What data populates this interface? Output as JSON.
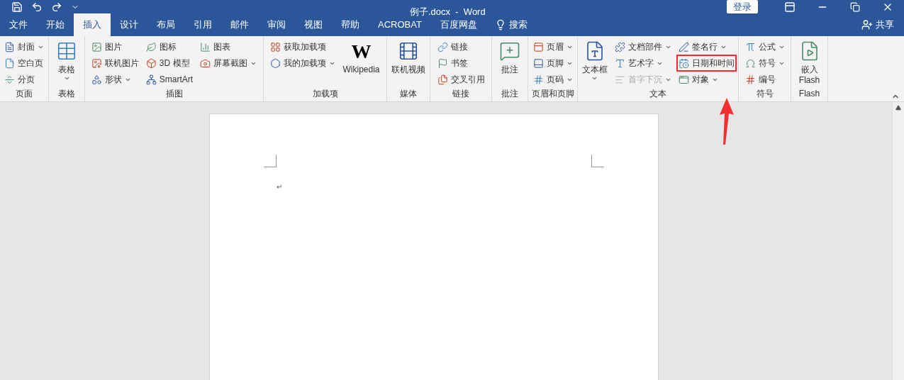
{
  "title_bar": {
    "title": "例子.docx  -  Word",
    "sign_in": "登录"
  },
  "tabs": [
    {
      "label": "文件",
      "selected": false
    },
    {
      "label": "开始",
      "selected": false
    },
    {
      "label": "插入",
      "selected": true
    },
    {
      "label": "设计",
      "selected": false
    },
    {
      "label": "布局",
      "selected": false
    },
    {
      "label": "引用",
      "selected": false
    },
    {
      "label": "邮件",
      "selected": false
    },
    {
      "label": "审阅",
      "selected": false
    },
    {
      "label": "视图",
      "selected": false
    },
    {
      "label": "帮助",
      "selected": false
    },
    {
      "label": "ACROBAT",
      "selected": false
    },
    {
      "label": "百度网盘",
      "selected": false
    }
  ],
  "search": "搜索",
  "share": "共享",
  "ribbon": {
    "groups": [
      {
        "label": "页面",
        "columns": [
          {
            "kind": "stack",
            "items": [
              {
                "label": "封面",
                "dropdown": true
              },
              {
                "label": "空白页",
                "dropdown": false
              },
              {
                "label": "分页",
                "dropdown": false
              }
            ]
          }
        ]
      },
      {
        "label": "表格",
        "columns": [
          {
            "kind": "large",
            "label": "表格",
            "dropdown": true
          }
        ]
      },
      {
        "label": "插图",
        "columns": [
          {
            "kind": "stack",
            "items": [
              {
                "label": "图片",
                "dropdown": false
              },
              {
                "label": "联机图片",
                "dropdown": false
              },
              {
                "label": "形状",
                "dropdown": true
              }
            ]
          },
          {
            "kind": "stack",
            "items": [
              {
                "label": "图标",
                "dropdown": false
              },
              {
                "label": "3D 模型",
                "dropdown": false
              },
              {
                "label": "SmartArt",
                "dropdown": false
              }
            ]
          },
          {
            "kind": "stack",
            "items": [
              {
                "label": "图表",
                "dropdown": false
              },
              {
                "label": "屏幕截图",
                "dropdown": true
              }
            ]
          }
        ]
      },
      {
        "label": "加载项",
        "columns": [
          {
            "kind": "stack",
            "items": [
              {
                "label": "获取加载项",
                "dropdown": false
              },
              {
                "label": "我的加载项",
                "dropdown": true
              }
            ]
          },
          {
            "kind": "large",
            "glyph": "W",
            "label": "Wikipedia",
            "dropdown": false
          }
        ]
      },
      {
        "label": "媒体",
        "columns": [
          {
            "kind": "large",
            "label": "联机视频",
            "dropdown": false
          }
        ]
      },
      {
        "label": "链接",
        "columns": [
          {
            "kind": "stack",
            "items": [
              {
                "label": "链接",
                "dropdown": false
              },
              {
                "label": "书签",
                "dropdown": false
              },
              {
                "label": "交叉引用",
                "dropdown": false
              }
            ]
          }
        ]
      },
      {
        "label": "批注",
        "columns": [
          {
            "kind": "large",
            "label": "批注",
            "dropdown": false
          }
        ]
      },
      {
        "label": "页眉和页脚",
        "columns": [
          {
            "kind": "stack",
            "items": [
              {
                "label": "页眉",
                "dropdown": true
              },
              {
                "label": "页脚",
                "dropdown": true
              },
              {
                "label": "页码",
                "dropdown": true
              }
            ]
          }
        ]
      },
      {
        "label": "文本",
        "columns": [
          {
            "kind": "large",
            "label": "文本框",
            "dropdown": true
          },
          {
            "kind": "stack",
            "items": [
              {
                "label": "文档部件",
                "dropdown": true
              },
              {
                "label": "艺术字",
                "dropdown": true
              },
              {
                "label": "首字下沉",
                "dropdown": true,
                "disabled": true
              }
            ]
          },
          {
            "kind": "stack",
            "items": [
              {
                "label": "签名行",
                "dropdown": true
              },
              {
                "label": "日期和时间",
                "dropdown": false,
                "highlighted": true
              },
              {
                "label": "对象",
                "dropdown": true
              }
            ]
          }
        ]
      },
      {
        "label": "符号",
        "columns": [
          {
            "kind": "stack",
            "items": [
              {
                "label": "公式",
                "dropdown": true
              },
              {
                "label": "符号",
                "dropdown": true
              },
              {
                "label": "编号",
                "dropdown": false
              }
            ]
          }
        ]
      },
      {
        "label": "Flash",
        "columns": [
          {
            "kind": "large",
            "label": "嵌入\nFlash",
            "dropdown": false
          }
        ]
      }
    ]
  },
  "document": {
    "paragraph_mark": "↵"
  }
}
